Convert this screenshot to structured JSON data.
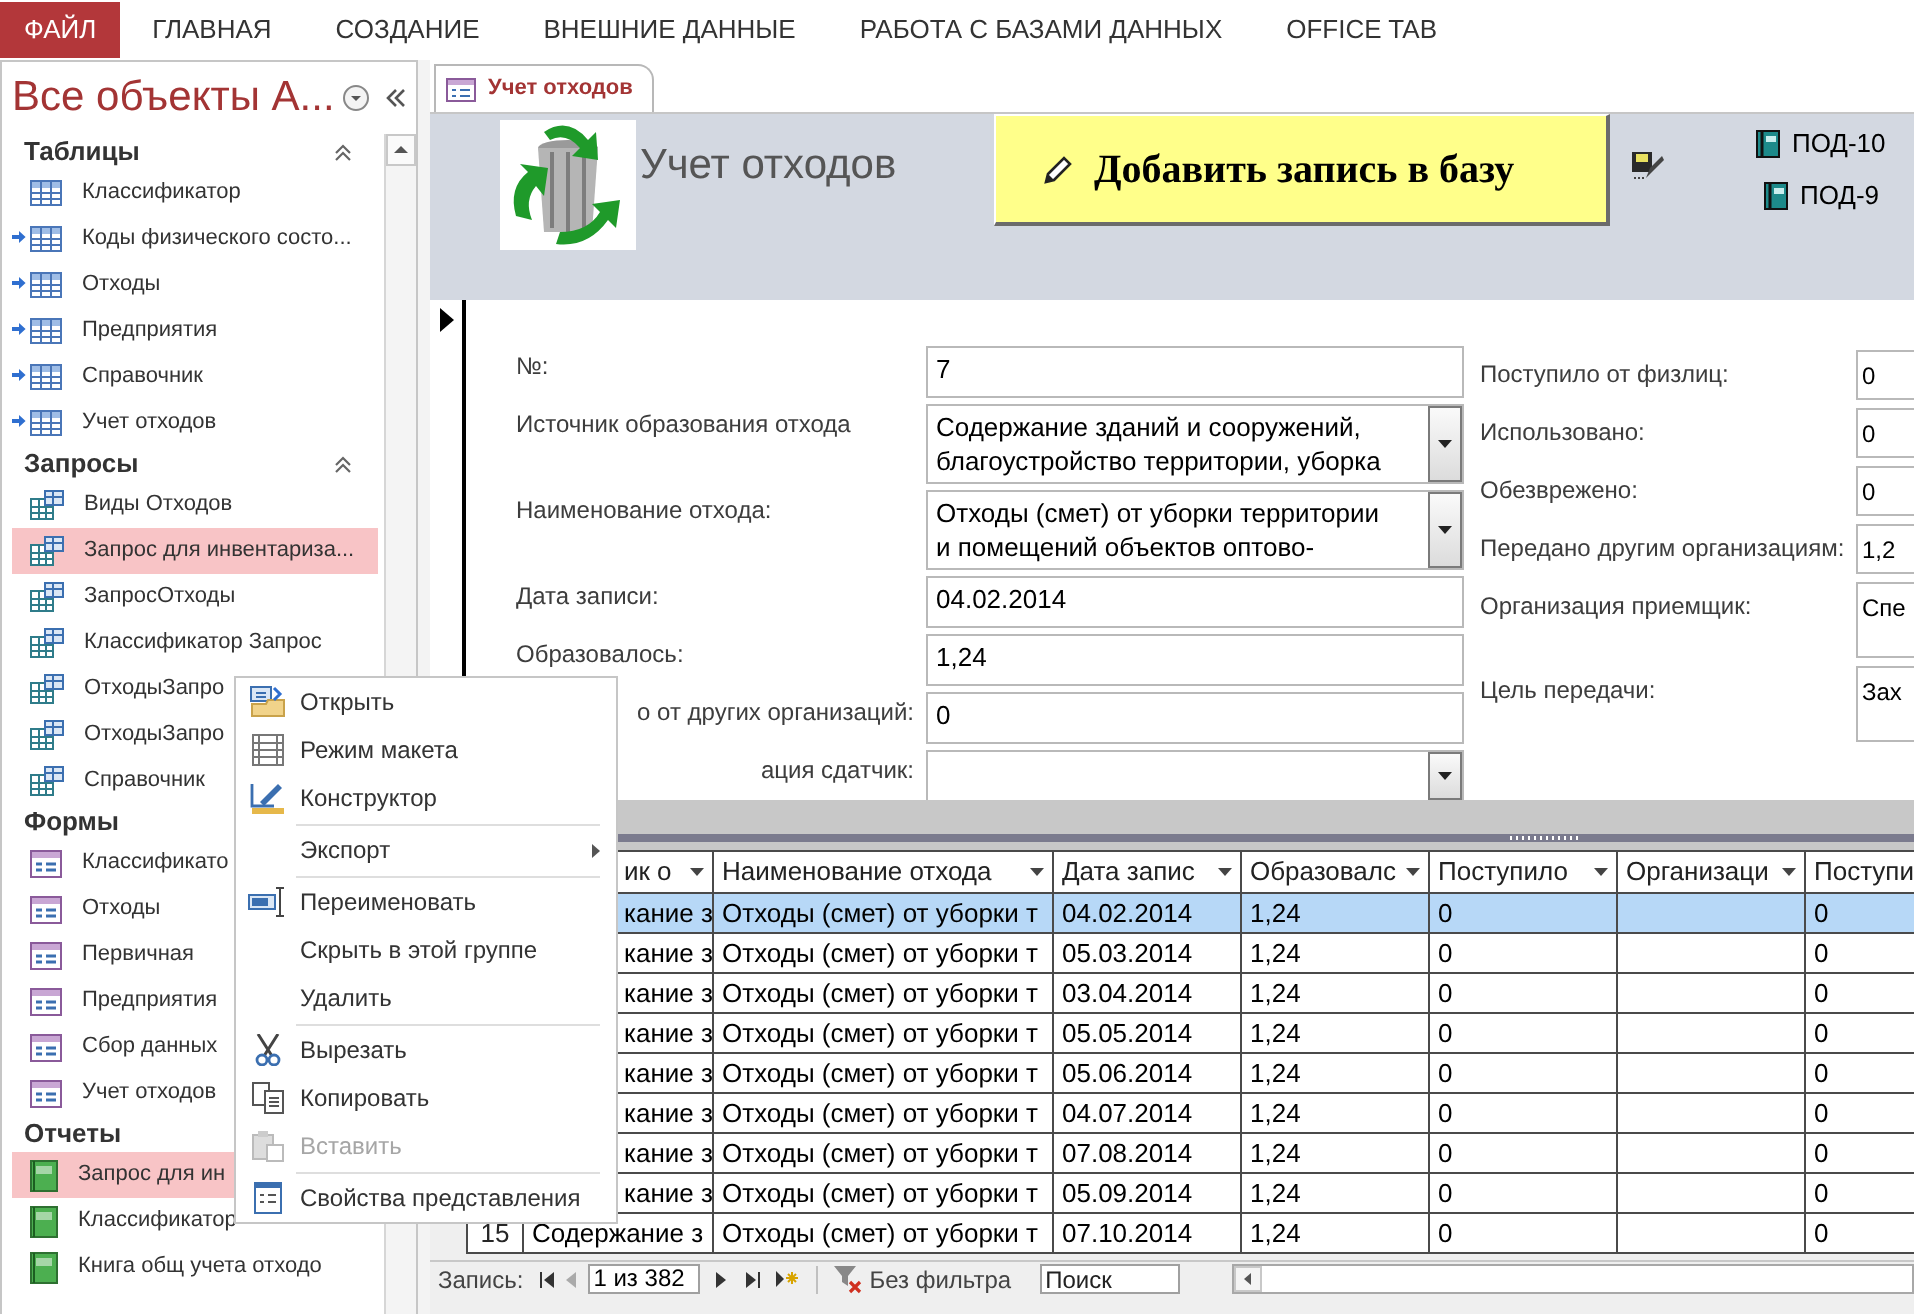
{
  "ribbon_tabs": [
    {
      "label": "ФАЙЛ",
      "selected": true
    },
    {
      "label": "ГЛАВНАЯ",
      "selected": false
    },
    {
      "label": "СОЗДАНИЕ",
      "selected": false
    },
    {
      "label": "ВНЕШНИЕ ДАННЫЕ",
      "selected": false
    },
    {
      "label": "РАБОТА С БАЗАМИ ДАННЫХ",
      "selected": false
    },
    {
      "label": "OFFICE TAB",
      "selected": false
    }
  ],
  "nav_pane": {
    "title": "Все объекты А...",
    "groups": [
      {
        "label": "Таблицы",
        "kind": "table",
        "collapse_button": true,
        "items": [
          {
            "label": "Классификатор",
            "linked": false,
            "selected": false
          },
          {
            "label": "Коды физического состо...",
            "linked": true,
            "selected": false
          },
          {
            "label": "Отходы",
            "linked": true,
            "selected": false
          },
          {
            "label": "Предприятия",
            "linked": true,
            "selected": false
          },
          {
            "label": "Справочник",
            "linked": true,
            "selected": false
          },
          {
            "label": "Учет отходов",
            "linked": true,
            "selected": false
          }
        ]
      },
      {
        "label": "Запросы",
        "kind": "query",
        "collapse_button": true,
        "items": [
          {
            "label": "Виды Отходов",
            "selected": false
          },
          {
            "label": "Запрос для инвентариза...",
            "selected": true
          },
          {
            "label": "ЗапросОтходы",
            "selected": false
          },
          {
            "label": "Классификатор Запрос",
            "selected": false
          },
          {
            "label": "ОтходыЗапро",
            "selected": false
          },
          {
            "label": "ОтходыЗапро",
            "selected": false
          },
          {
            "label": "Справочник",
            "selected": false
          }
        ]
      },
      {
        "label": "Формы",
        "kind": "form",
        "items": [
          {
            "label": "Классификато",
            "selected": false
          },
          {
            "label": "Отходы",
            "selected": false
          },
          {
            "label": "Первичная",
            "selected": false
          },
          {
            "label": "Предприятия",
            "selected": false
          },
          {
            "label": "Сбор данных",
            "selected": false
          },
          {
            "label": "Учет отходов",
            "selected": false
          }
        ]
      },
      {
        "label": "Отчеты",
        "kind": "report",
        "items": [
          {
            "label": "Запрос для ин",
            "selected": true
          },
          {
            "label": "Классификатор",
            "selected": false
          },
          {
            "label": "Книга общ учета отходо",
            "selected": false
          }
        ]
      }
    ]
  },
  "document_tab": {
    "label": "Учет отходов"
  },
  "form_header": {
    "title": "Учет отходов",
    "add_button": "Добавить запись в базу",
    "report_buttons": [
      "ПОД-10",
      "ПОД-9"
    ]
  },
  "form_fields_left": [
    {
      "label": "№:",
      "value": [
        "7"
      ],
      "kind": "text",
      "clipped": false
    },
    {
      "label": "Источник образования отхода",
      "value": [
        "Содержание зданий и сооружений,",
        "благоустройство территории, уборка"
      ],
      "kind": "combo",
      "clipped": false
    },
    {
      "label": "Наименование отхода:",
      "value": [
        "Отходы (смет) от уборки территории",
        "и помещений объектов оптово-"
      ],
      "kind": "combo",
      "clipped": false
    },
    {
      "label": "Дата записи:",
      "value": [
        "04.02.2014"
      ],
      "kind": "text",
      "clipped": false
    },
    {
      "label": "Образовалось:",
      "value": [
        "1,24"
      ],
      "kind": "text",
      "clipped": false
    },
    {
      "label": "о от других организаций:",
      "value": [
        "0"
      ],
      "kind": "text",
      "clipped": true
    },
    {
      "label": "ация сдатчик:",
      "kind": "combo",
      "clipped": true
    }
  ],
  "form_fields_right": [
    {
      "label": "Поступило от физлиц:",
      "value": "0",
      "kind": "text"
    },
    {
      "label": "Использовано:",
      "value": "0",
      "kind": "text"
    },
    {
      "label": "Обезврежено:",
      "value": "0",
      "kind": "text"
    },
    {
      "label": "Передано другим организациям:",
      "value": "1,2",
      "kind": "text"
    },
    {
      "label": "Организация приемщик:",
      "value": "Спе",
      "kind": "memo"
    },
    {
      "label": "Цель передачи:",
      "value": "Зах",
      "kind": "memo"
    }
  ],
  "datasheet": {
    "columns": [
      {
        "label": "ик о",
        "menu_arrow": true
      },
      {
        "label": "Наименование отхода",
        "menu_arrow": true
      },
      {
        "label": "Дата запис",
        "menu_arrow": true
      },
      {
        "label": "Образовалс",
        "menu_arrow": true
      },
      {
        "label": "Поступило",
        "menu_arrow": true
      },
      {
        "label": "Организаци",
        "menu_arrow": true
      },
      {
        "label": "Поступи"
      }
    ],
    "rows": [
      {
        "source": "кание з",
        "name": "Отходы (смет) от уборки т",
        "date": "04.02.2014",
        "formed": "1,24",
        "received": "0",
        "received_2": "0",
        "selected": true
      },
      {
        "source": "кание з",
        "name": "Отходы (смет) от уборки т",
        "date": "05.03.2014",
        "formed": "1,24",
        "received": "0",
        "received_2": "0",
        "selected": false
      },
      {
        "source": "кание з",
        "name": "Отходы (смет) от уборки т",
        "date": "03.04.2014",
        "formed": "1,24",
        "received": "0",
        "received_2": "0",
        "selected": false
      },
      {
        "source": "кание з",
        "name": "Отходы (смет) от уборки т",
        "date": "05.05.2014",
        "formed": "1,24",
        "received": "0",
        "received_2": "0",
        "selected": false
      },
      {
        "source": "кание з",
        "name": "Отходы (смет) от уборки т",
        "date": "05.06.2014",
        "formed": "1,24",
        "received": "0",
        "received_2": "0",
        "selected": false
      },
      {
        "source": "кание з",
        "name": "Отходы (смет) от уборки т",
        "date": "04.07.2014",
        "formed": "1,24",
        "received": "0",
        "received_2": "0",
        "selected": false
      },
      {
        "source": "кание з",
        "name": "Отходы (смет) от уборки т",
        "date": "07.08.2014",
        "formed": "1,24",
        "received": "0",
        "received_2": "0",
        "selected": false
      },
      {
        "source": "кание з",
        "name": "Отходы (смет) от уборки т",
        "date": "05.09.2014",
        "formed": "1,24",
        "received": "0",
        "received_2": "0",
        "selected": false
      },
      {
        "number": "15",
        "source": "Содержание з",
        "name": "Отходы (смет) от уборки т",
        "date": "07.10.2014",
        "formed": "1,24",
        "received": "0",
        "received_2": "0",
        "selected": false
      }
    ]
  },
  "record_nav": {
    "label": "Запись:",
    "position": "1 из 382",
    "filter": "Без фильтра",
    "placeholder": "Поиск"
  },
  "context_menu": [
    {
      "label": "Открыть",
      "kind": "open",
      "separator_before": false,
      "submenu": false,
      "disabled": false
    },
    {
      "label": "Режим макета",
      "kind": "layout",
      "separator_before": false,
      "submenu": false,
      "disabled": false
    },
    {
      "label": "Конструктор",
      "kind": "design",
      "separator_before": false,
      "submenu": false,
      "disabled": false
    },
    {
      "label": "Экспорт",
      "kind": "plain",
      "separator_before": true,
      "submenu": true,
      "disabled": false
    },
    {
      "label": "Переименовать",
      "kind": "rename",
      "separator_before": true,
      "submenu": false,
      "disabled": false
    },
    {
      "label": "Скрыть в этой группе",
      "kind": "plain",
      "separator_before": false,
      "submenu": false,
      "disabled": false
    },
    {
      "label": "Удалить",
      "kind": "plain",
      "separator_before": false,
      "submenu": false,
      "disabled": false
    },
    {
      "label": "Вырезать",
      "kind": "cut",
      "separator_before": true,
      "submenu": false,
      "disabled": false
    },
    {
      "label": "Копировать",
      "kind": "copy",
      "separator_before": false,
      "submenu": false,
      "disabled": false
    },
    {
      "label": "Вставить",
      "kind": "paste",
      "separator_before": false,
      "submenu": false,
      "disabled": true
    },
    {
      "label": "Свойства представления",
      "kind": "properties",
      "separator_before": true,
      "submenu": false,
      "disabled": false
    }
  ]
}
